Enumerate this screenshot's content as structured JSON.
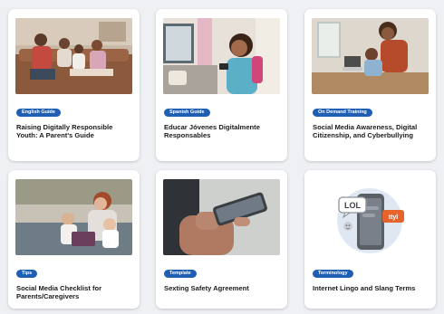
{
  "cards": [
    {
      "tag": "English Guide",
      "title": "Raising Digitally Responsible Youth: A Parent's Guide",
      "image": "family-on-couch-photo"
    },
    {
      "tag": "Spanish Guide",
      "title": "Educar Jóvenes Digitalmente Responsables",
      "image": "girl-with-phone-photo"
    },
    {
      "tag": "On Demand Training",
      "title": "Social Media Awareness, Digital Citizenship, and Cyberbullying",
      "image": "mother-and-son-at-laptop-photo"
    },
    {
      "tag": "Tips",
      "title": "Social Media Checklist for Parents/Caregivers",
      "image": "mother-with-children-tablet-photo"
    },
    {
      "tag": "Template",
      "title": "Sexting Safety Agreement",
      "image": "hands-holding-phone-photo"
    },
    {
      "tag": "Terminology",
      "title": "Internet Lingo and Slang Terms",
      "image": "phone-chat-bubbles-illustration"
    }
  ],
  "illustration": {
    "bubble_top": "LOL",
    "bubble_side": "ttyl"
  },
  "colors": {
    "badge": "#1e5fb4",
    "card": "#ffffff",
    "page": "#eef0f3"
  }
}
